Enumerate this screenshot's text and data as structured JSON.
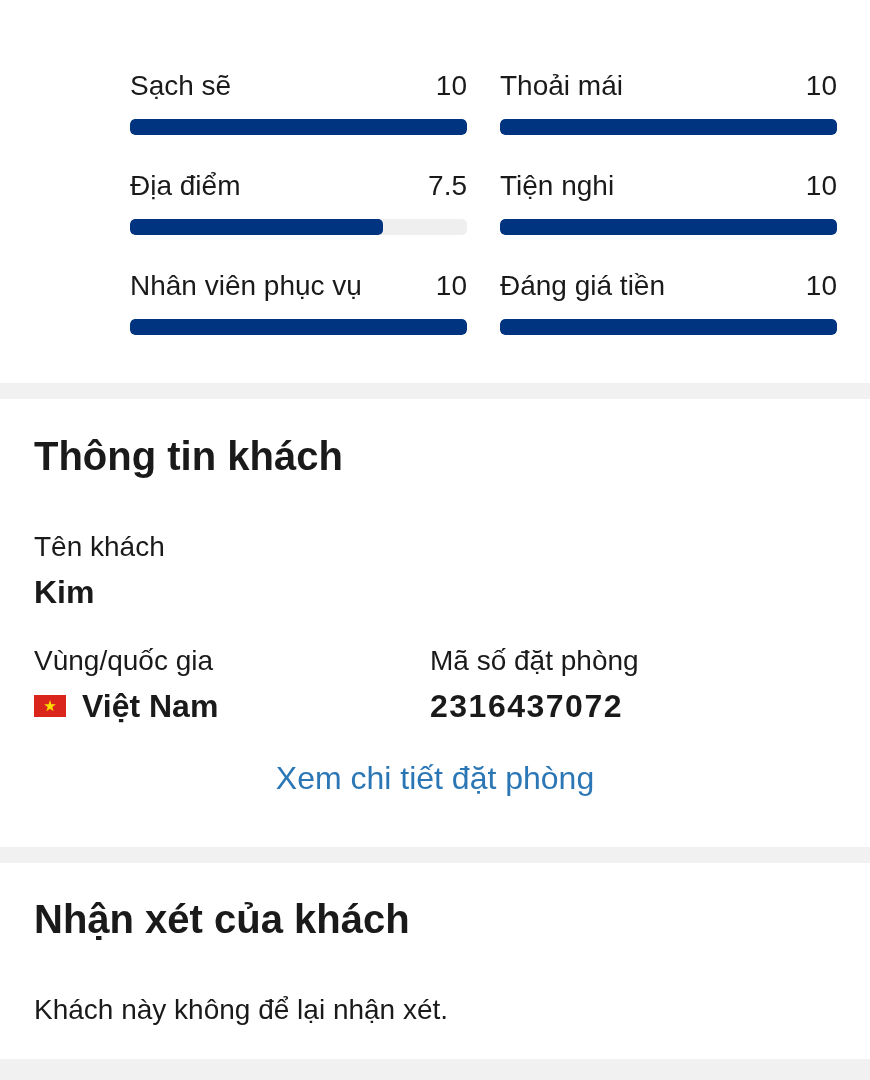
{
  "ratings": [
    {
      "label": "Sạch sẽ",
      "score": "10",
      "level": 1
    },
    {
      "label": "Thoải mái",
      "score": "10",
      "level": 1
    },
    {
      "label": "Địa điểm",
      "score": "7.5",
      "level": 0.75
    },
    {
      "label": "Tiện nghi",
      "score": "10",
      "level": 1
    },
    {
      "label": "Nhân viên phục vụ",
      "score": "10",
      "level": 1
    },
    {
      "label": "Đáng giá tiền",
      "score": "10",
      "level": 1
    }
  ],
  "guest_info": {
    "title": "Thông tin khách",
    "name": {
      "label": "Tên khách",
      "value": "Kim"
    },
    "country": {
      "label": "Vùng/quốc gia",
      "value": "Việt Nam"
    },
    "booking_number": {
      "label": "Mã số đặt phòng",
      "value": "2316437072"
    },
    "link": "Xem chi tiết đặt phòng"
  },
  "guest_review": {
    "title": "Nhận xét của khách",
    "text": "Khách này không để lại nhận xét."
  }
}
